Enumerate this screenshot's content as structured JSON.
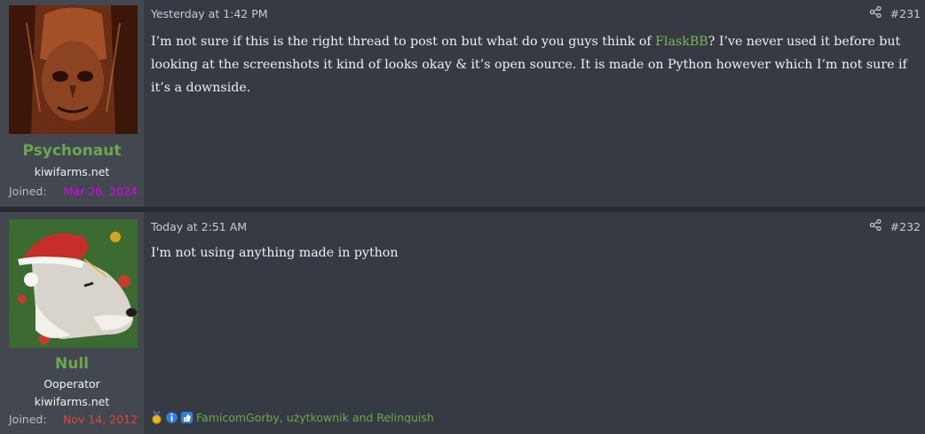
{
  "posts": [
    {
      "username": "Psychonaut",
      "site": "kiwifarms.net",
      "joined_label": "Joined:",
      "joined_date": "Mar 26, 2024",
      "date": "Yesterday at 1:42 PM",
      "number": "#231",
      "body_before": "I’m not sure if this is the right thread to post on but what do you guys think of ",
      "link_text": "FlaskBB",
      "body_after": "? I’ve never used it before but looking at the screenshots it kind of looks okay & it’s open source. It is made on Python however which I’m not sure if it’s a downside."
    },
    {
      "username": "Null",
      "title": "Ooperator",
      "site": "kiwifarms.net",
      "joined_label": "Joined:",
      "joined_date": "Nov 14, 2012",
      "date": "Today at 2:51 AM",
      "number": "#232",
      "body": "I'm not using anything made in python",
      "reactions_text": "FamicomGorby, użytkownik and Relinquish"
    }
  ],
  "icons": {
    "share": "share-icon",
    "reactions": [
      "medal-icon",
      "informative-icon",
      "like-icon"
    ]
  },
  "colors": {
    "username": "#6aa84f",
    "joined_psychonaut": "#e000ff",
    "joined_null": "#e0443c",
    "link": "#7fb35c"
  }
}
